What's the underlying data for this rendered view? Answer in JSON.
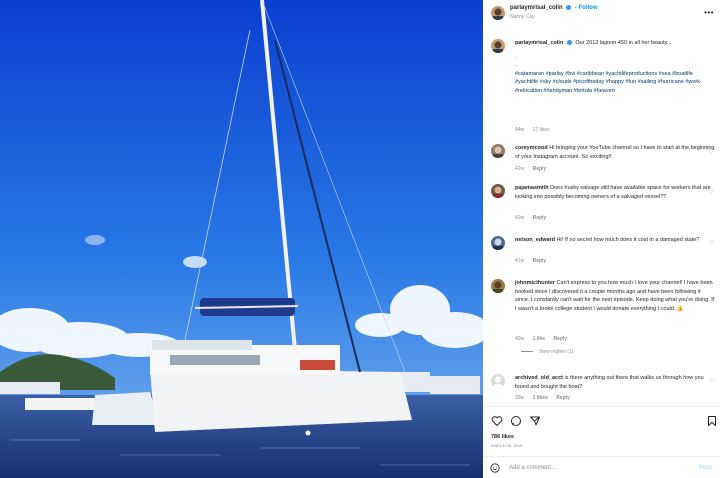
{
  "photo": {
    "alt_icon": "catamaran-photo"
  },
  "header": {
    "username": "parlaymrisal_colin",
    "follow_label": "Follow",
    "location": "Nanny Cay",
    "more_icon": "more-options-icon"
  },
  "caption": {
    "username": "parlaymrisal_colin",
    "text": "Our 2012 lagoon 450 in all her beauty...",
    "dots": ".",
    "hashtags": "#catamaran #parlay #bvi #caribbean #yachtlifeproductions #sea #boatlife #yachtlife #sky #clouds #picoftheday #happy #fun #sailing #hurricane #work #relocation #handyman #tortola #heaven",
    "time": "44w",
    "likes": "17 likes"
  },
  "comments": [
    {
      "username": "coreymcood",
      "text": "Hi bringing your YouTube channel so I have to start at the beginning of your Instagram account. So exciting!!",
      "time": "42w",
      "reply": "Reply"
    },
    {
      "username": "pajamasmith",
      "text": "Does husky salvage still have available space for workers that are looking into possibly becoming owners of a salvaged vessel??",
      "time": "42w",
      "reply": "Reply"
    },
    {
      "username": "nelson_edward",
      "text": "Hi! If no secret how much does it cost in a damaged state?",
      "time": "41w",
      "reply": "Reply"
    },
    {
      "username": "johnmicthunter",
      "text": "Can't express to you how much I love your channel! I have been hooked since I discovered it a couple months ago and have been following it since. I constantly can't wait for the next episode. Keep doing what you're doing. If I wasn't a broke college student I would donate everything I could. 👍",
      "time": "40w",
      "likes": "1 like",
      "reply": "Reply",
      "view_replies": "View replies (1)"
    },
    {
      "username": "archived_old_acct",
      "text": "is there anything out there that walks us through how you found and bought the boat?",
      "time": "39w",
      "likes": "2 likes",
      "reply": "Reply"
    }
  ],
  "footer": {
    "likes": "786 likes",
    "date": "March 26, 2018",
    "add_comment_placeholder": "Add a comment...",
    "post_label": "Post"
  },
  "colors": {
    "sky_top": "#0a3fd0",
    "sky_bottom": "#5a9ff0",
    "sea": "#1e3f8a",
    "link": "#0095f6",
    "hashtag": "#00376b"
  }
}
